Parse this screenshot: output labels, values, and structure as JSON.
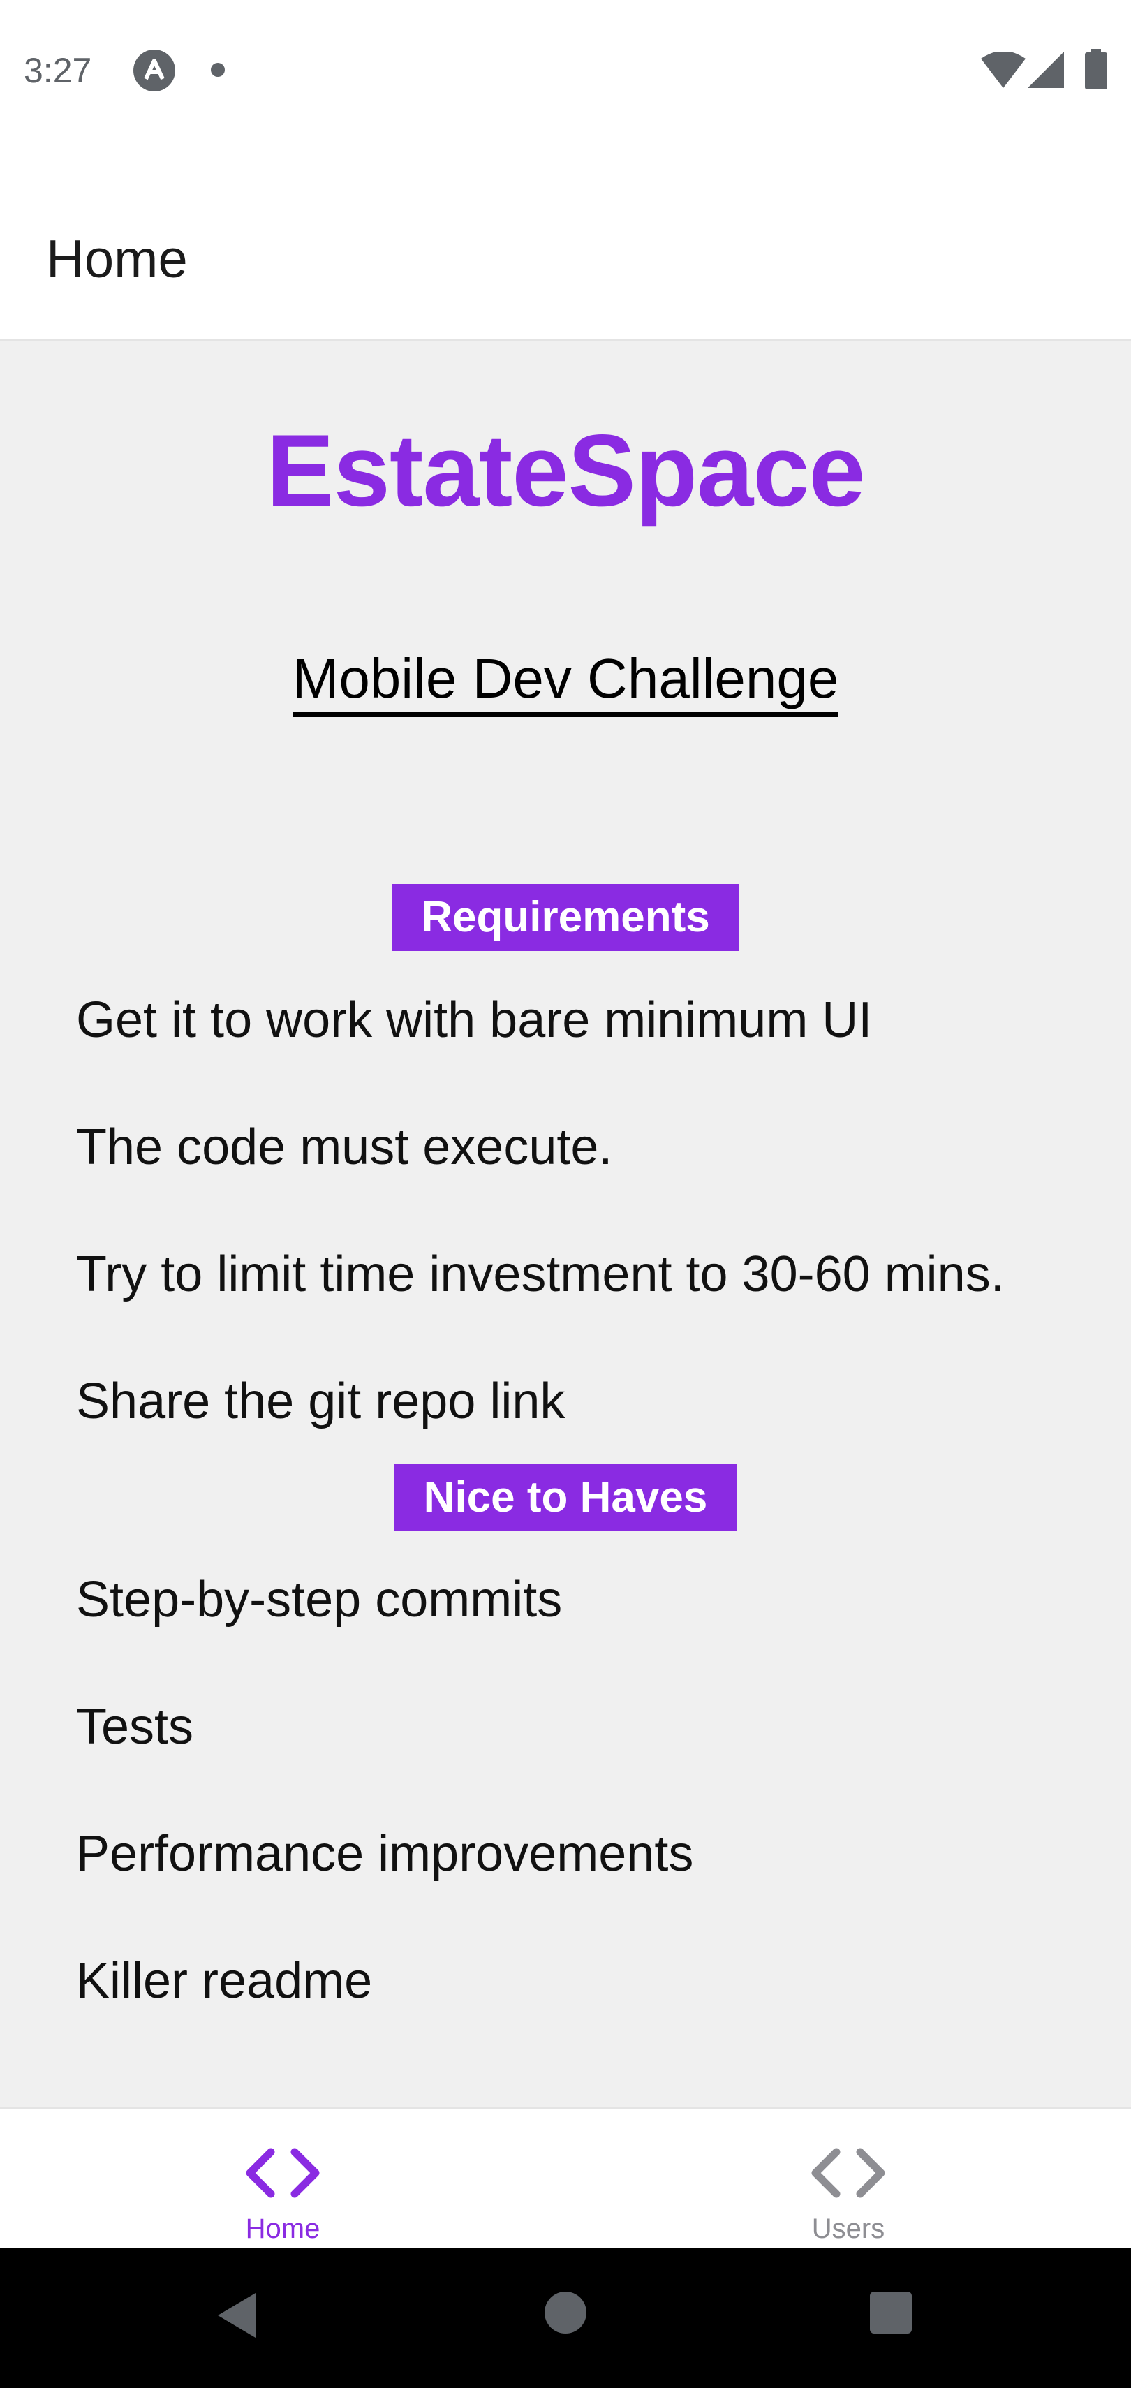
{
  "status_bar": {
    "time": "3:27",
    "icons": [
      "app-notification-icon",
      "dot-icon",
      "wifi-icon",
      "signal-icon",
      "battery-icon"
    ]
  },
  "header": {
    "title": "Home"
  },
  "main": {
    "brand": "EstateSpace",
    "subtitle": "Mobile Dev Challenge",
    "sections": [
      {
        "title": "Requirements",
        "items": [
          "Get it to work with bare minimum UI",
          "The code must execute.",
          "Try to limit time investment to 30-60 mins.",
          "Share the git repo link"
        ]
      },
      {
        "title": "Nice to Haves",
        "items": [
          "Step-by-step commits",
          "Tests",
          "Performance improvements",
          "Killer readme"
        ]
      }
    ]
  },
  "tab_bar": {
    "tabs": [
      {
        "label": "Home",
        "icon": "code-brackets-icon",
        "active": true
      },
      {
        "label": "Users",
        "icon": "code-brackets-icon",
        "active": false
      }
    ]
  },
  "colors": {
    "accent": "#8a2be2",
    "inactive": "#8e8e93",
    "background": "#f0f0f0"
  },
  "nav_bar": {
    "buttons": [
      "back-icon",
      "home-circle-icon",
      "recents-square-icon"
    ]
  }
}
